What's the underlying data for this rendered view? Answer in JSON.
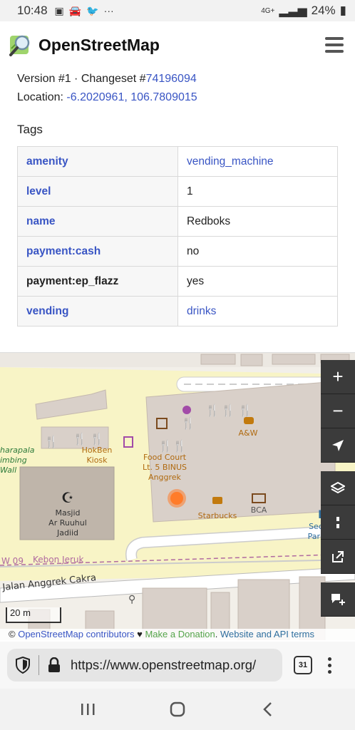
{
  "status_bar": {
    "time": "10:48",
    "left_icons": [
      "image-icon",
      "car-icon",
      "twitter-icon",
      "more-icon"
    ],
    "more": "···",
    "network": "4G+",
    "battery": "24%"
  },
  "header": {
    "brand": "OpenStreetMap"
  },
  "meta": {
    "version_prefix": "Version #1 · Changeset #",
    "changeset": "74196094",
    "location_prefix": "Location: ",
    "location": "-6.2020961, 106.7809015"
  },
  "tags": {
    "title": "Tags",
    "rows": [
      {
        "key": "amenity",
        "value": "vending_machine",
        "key_link": true,
        "value_link": true
      },
      {
        "key": "level",
        "value": "1",
        "key_link": true,
        "value_link": false
      },
      {
        "key": "name",
        "value": "Redboks",
        "key_link": true,
        "value_link": false
      },
      {
        "key": "payment:cash",
        "value": "no",
        "key_link": true,
        "value_link": false
      },
      {
        "key": "payment:ep_flazz",
        "value": "yes",
        "key_link": false,
        "value_link": false
      },
      {
        "key": "vending",
        "value": "drinks",
        "key_link": true,
        "value_link": true
      }
    ]
  },
  "map": {
    "labels": {
      "hokben": "HokBen",
      "kiosk": "Kiosk",
      "food_court_1": "Food Court",
      "food_court_2": "Lt. 5 BINUS",
      "food_court_3": "Anggrek",
      "aw": "A&W",
      "starbucks": "Starbucks",
      "bca": "BCA",
      "masjid_1": "Masjid",
      "masjid_2": "Ar Ruuhul",
      "masjid_3": "Jadiid",
      "harapala_1": "harapala",
      "harapala_2": "imbing",
      "harapala_3": "Wall",
      "secure_1": "Secure",
      "secure_2": "Parking",
      "rw": "W 09",
      "kebon_jeruk": "Kebon Jeruk",
      "street": "Jalan Anggrek Cakra"
    },
    "controls": {
      "zoom_in": "+",
      "zoom_out": "−"
    },
    "scale_label": "20 m",
    "attribution": {
      "copy": "© ",
      "contributors": "OpenStreetMap contributors",
      "heart": " ♥ ",
      "donate": "Make a Donation",
      "dot": ". ",
      "terms": "Website and API terms"
    }
  },
  "browser": {
    "url": "https://www.openstreetmap.org/",
    "tab_count": "31"
  }
}
